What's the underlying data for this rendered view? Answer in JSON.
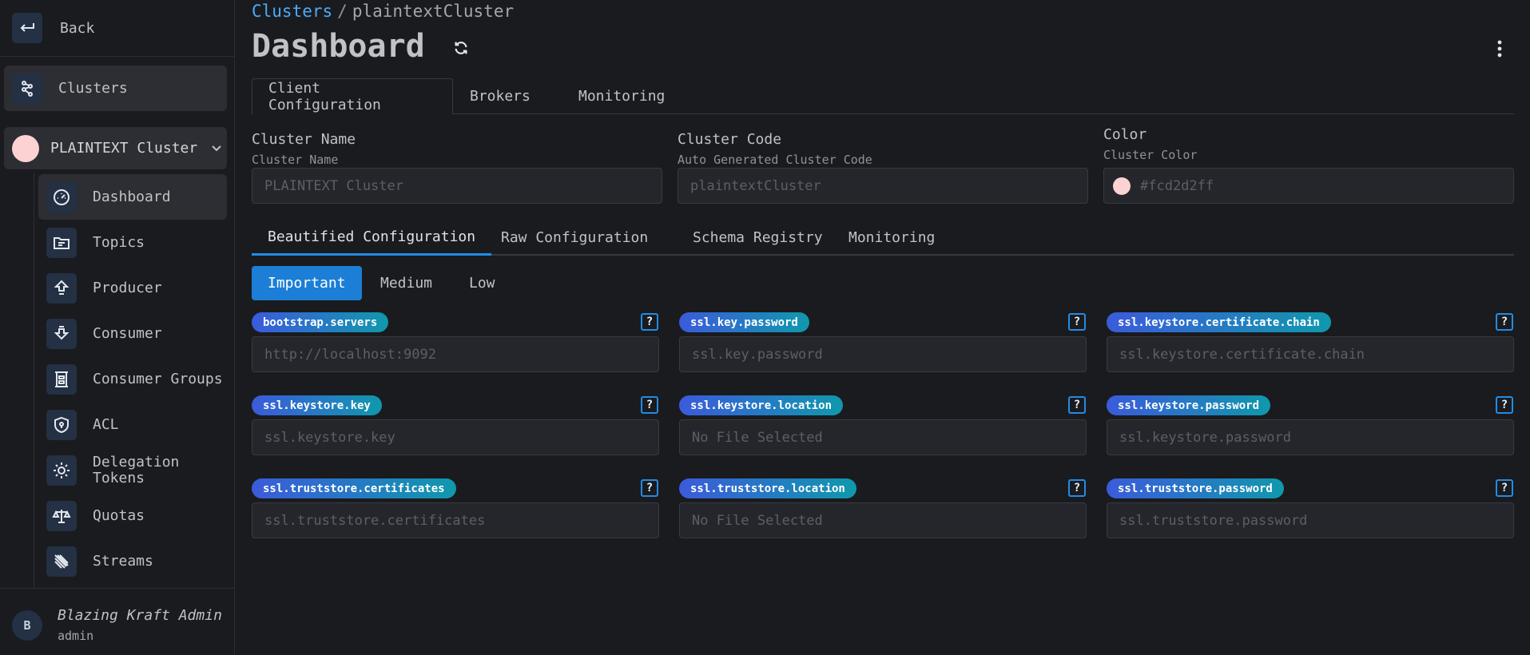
{
  "sidebar": {
    "back_label": "Back",
    "clusters_label": "Clusters",
    "cluster_name": "PLAINTEXT Cluster",
    "items": [
      {
        "label": "Dashboard",
        "icon": "gauge-icon"
      },
      {
        "label": "Topics",
        "icon": "folder-icon"
      },
      {
        "label": "Producer",
        "icon": "upload-icon"
      },
      {
        "label": "Consumer",
        "icon": "download-icon"
      },
      {
        "label": "Consumer Groups",
        "icon": "group-icon"
      },
      {
        "label": "ACL",
        "icon": "shield-icon"
      },
      {
        "label": "Delegation Tokens",
        "icon": "sun-icon"
      },
      {
        "label": "Quotas",
        "icon": "scale-icon"
      },
      {
        "label": "Streams",
        "icon": "streams-icon"
      }
    ],
    "user": {
      "initial": "B",
      "name": "Blazing Kraft Admin",
      "role": "admin"
    }
  },
  "breadcrumb": {
    "root": "Clusters",
    "separator": "/",
    "current": "plaintextCluster"
  },
  "page_title": "Dashboard",
  "top_tabs": [
    "Client Configuration",
    "Brokers",
    "Monitoring"
  ],
  "fields": {
    "name": {
      "label": "Cluster Name",
      "desc": "Cluster Name",
      "value": "PLAINTEXT Cluster"
    },
    "code": {
      "label": "Cluster Code",
      "desc": "Auto Generated Cluster Code",
      "value": "plaintextCluster"
    },
    "color": {
      "label": "Color",
      "desc": "Cluster Color",
      "value": "#fcd2d2ff"
    }
  },
  "config_tabs": [
    "Beautified Configuration",
    "Raw Configuration",
    "Schema Registry",
    "Monitoring"
  ],
  "importance": [
    "Important",
    "Medium",
    "Low"
  ],
  "help_glyph": "?",
  "config_fields": [
    {
      "key": "bootstrap.servers",
      "placeholder": "http://localhost:9092"
    },
    {
      "key": "ssl.key.password",
      "placeholder": "ssl.key.password"
    },
    {
      "key": "ssl.keystore.certificate.chain",
      "placeholder": "ssl.keystore.certificate.chain"
    },
    {
      "key": "ssl.keystore.key",
      "placeholder": "ssl.keystore.key"
    },
    {
      "key": "ssl.keystore.location",
      "placeholder": "No File Selected"
    },
    {
      "key": "ssl.keystore.password",
      "placeholder": "ssl.keystore.password"
    },
    {
      "key": "ssl.truststore.certificates",
      "placeholder": "ssl.truststore.certificates"
    },
    {
      "key": "ssl.truststore.location",
      "placeholder": "No File Selected"
    },
    {
      "key": "ssl.truststore.password",
      "placeholder": "ssl.truststore.password"
    }
  ],
  "colors": {
    "accent": "#228be6",
    "cluster": "#fcd2d2",
    "link": "#4dabf7"
  }
}
